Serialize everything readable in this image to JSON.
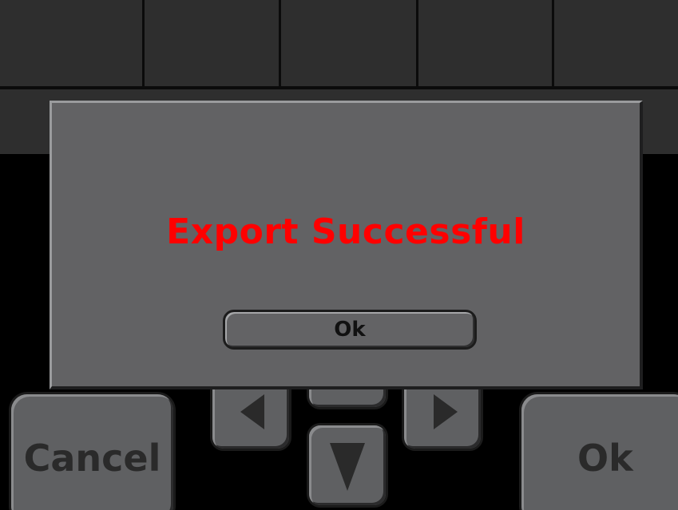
{
  "dialog": {
    "message": "Export Successful",
    "ok_label": "Ok"
  },
  "buttons": {
    "cancel_label": "Cancel",
    "ok_label": "Ok"
  },
  "icons": {
    "left": "left-arrow-icon",
    "right": "right-arrow-icon",
    "up": "up-arrow-icon",
    "down": "down-arrow-icon"
  },
  "colors": {
    "message": "#ff0000",
    "dialog_bg": "#626264",
    "button_bg": "#5f6062",
    "screen_bg": "#000000",
    "grid_cell": "#2e2e2e"
  }
}
